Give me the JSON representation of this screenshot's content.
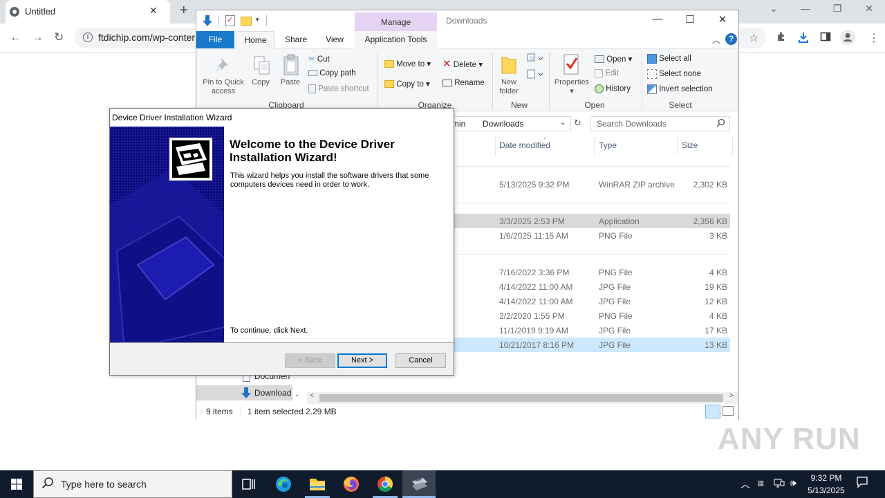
{
  "browser": {
    "tab_title": "Untitled",
    "tab_close": "✕",
    "new_tab": "+",
    "url": "ftdichip.com/wp-conter",
    "nav_back": "←",
    "nav_forward": "→",
    "nav_reload": "↻",
    "window_minimize": "—",
    "window_restore": "❐",
    "window_close": "✕",
    "tab_search": "⌄"
  },
  "explorer": {
    "title": "Downloads",
    "manage_label": "Manage",
    "tabs": {
      "file": "File",
      "home": "Home",
      "share": "Share",
      "view": "View",
      "app_tools": "Application Tools"
    },
    "ribbon": {
      "clipboard": {
        "label": "Clipboard",
        "pin_line1": "Pin to Quick",
        "pin_line2": "access",
        "copy": "Copy",
        "paste": "Paste",
        "cut": "Cut",
        "copy_path": "Copy path",
        "paste_shortcut": "Paste shortcut"
      },
      "organize": {
        "label": "Organize",
        "move_to": "Move to",
        "copy_to": "Copy to",
        "delete": "Delete",
        "rename": "Rename"
      },
      "new": {
        "label": "New",
        "new_folder_line1": "New",
        "new_folder_line2": "folder"
      },
      "open": {
        "label": "Open",
        "properties": "Properties",
        "open": "Open",
        "edit": "Edit",
        "history": "History"
      },
      "select": {
        "label": "Select",
        "select_all": "Select all",
        "select_none": "Select none",
        "invert": "Invert selection"
      }
    },
    "address_part1": "min",
    "address_part2": "Downloads",
    "search_placeholder": "Search Downloads",
    "columns": {
      "date": "Date modified",
      "type": "Type",
      "size": "Size"
    },
    "rows": [
      {
        "date": "5/13/2025 9:32 PM",
        "type": "WinRAR ZIP archive",
        "size": "2,302 KB"
      },
      {
        "date": "3/3/2025 2:53 PM",
        "type": "Application",
        "size": "2,356 KB"
      },
      {
        "date": "1/6/2025 11:15 AM",
        "type": "PNG File",
        "size": "3 KB"
      },
      {
        "date": "7/16/2022 3:36 PM",
        "type": "PNG File",
        "size": "4 KB"
      },
      {
        "date": "4/14/2022 11:00 AM",
        "type": "JPG File",
        "size": "19 KB"
      },
      {
        "date": "4/14/2022 11:00 AM",
        "type": "JPG File",
        "size": "12 KB"
      },
      {
        "date": "2/2/2020 1:55 PM",
        "type": "PNG File",
        "size": "4 KB"
      },
      {
        "date": "11/1/2019 9:19 AM",
        "type": "JPG File",
        "size": "17 KB"
      },
      {
        "date": "10/21/2017 8:16 PM",
        "type": "JPG File",
        "size": "13 KB"
      }
    ],
    "nav": {
      "documents": "Documen",
      "downloads": "Download"
    },
    "status": {
      "items": "9 items",
      "selected": "1 item selected",
      "size": "2.29 MB"
    }
  },
  "wizard": {
    "title": "Device Driver Installation Wizard",
    "heading": "Welcome to the Device Driver Installation Wizard!",
    "description": "This wizard helps you install the software drivers that some computers devices need in order to work.",
    "continue_text": "To continue, click Next.",
    "back_button": "< Back",
    "next_button": "Next >",
    "cancel_button": "Cancel"
  },
  "watermark": "ANY RUN",
  "taskbar": {
    "search_placeholder": "Type here to search",
    "time": "9:32 PM",
    "date": "5/13/2025"
  }
}
